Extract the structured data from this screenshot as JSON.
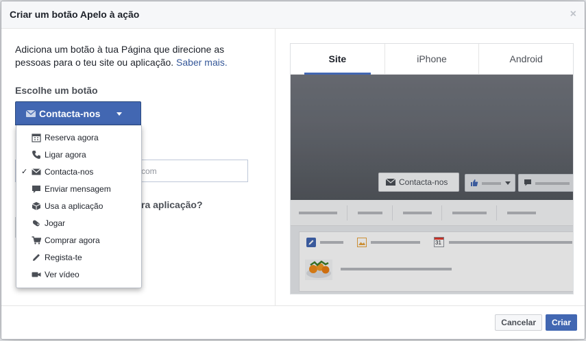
{
  "dialog": {
    "title": "Criar um botão Apelo à ação",
    "close_glyph": "×"
  },
  "left": {
    "description": "Adiciona um botão à tua Página que direcione as pessoas para o teu site ou aplicação.",
    "learn_more": "Saber mais.",
    "choose_label": "Escolhe um botão",
    "selected_button": "Contacta-nos",
    "hidden_input_fragment": "com",
    "hidden_question_fragment": "ra aplicação?"
  },
  "menu": {
    "items": [
      {
        "label": "Reserva agora",
        "icon": "calendar-icon",
        "checked": false
      },
      {
        "label": "Ligar agora",
        "icon": "phone-icon",
        "checked": false
      },
      {
        "label": "Contacta-nos",
        "icon": "envelope-icon",
        "checked": true
      },
      {
        "label": "Enviar mensagem",
        "icon": "chat-bubble-icon",
        "checked": false
      },
      {
        "label": "Usa a aplicação",
        "icon": "cube-icon",
        "checked": false
      },
      {
        "label": "Jogar",
        "icon": "gamepad-icon",
        "checked": false
      },
      {
        "label": "Comprar agora",
        "icon": "cart-icon",
        "checked": false
      },
      {
        "label": "Regista-te",
        "icon": "pencil-icon",
        "checked": false
      },
      {
        "label": "Ver vídeo",
        "icon": "video-camera-icon",
        "checked": false
      }
    ],
    "check_glyph": "✓"
  },
  "preview": {
    "tabs": [
      {
        "label": "Site",
        "active": true
      },
      {
        "label": "iPhone",
        "active": false
      },
      {
        "label": "Android",
        "active": false
      }
    ],
    "cover_button": "Contacta-nos",
    "calendar_day": "31"
  },
  "footer": {
    "cancel_label": "Cancelar",
    "create_label": "Criar"
  },
  "colors": {
    "primary": "#4267b2",
    "link": "#365899",
    "header_bg": "#f6f7f9"
  }
}
